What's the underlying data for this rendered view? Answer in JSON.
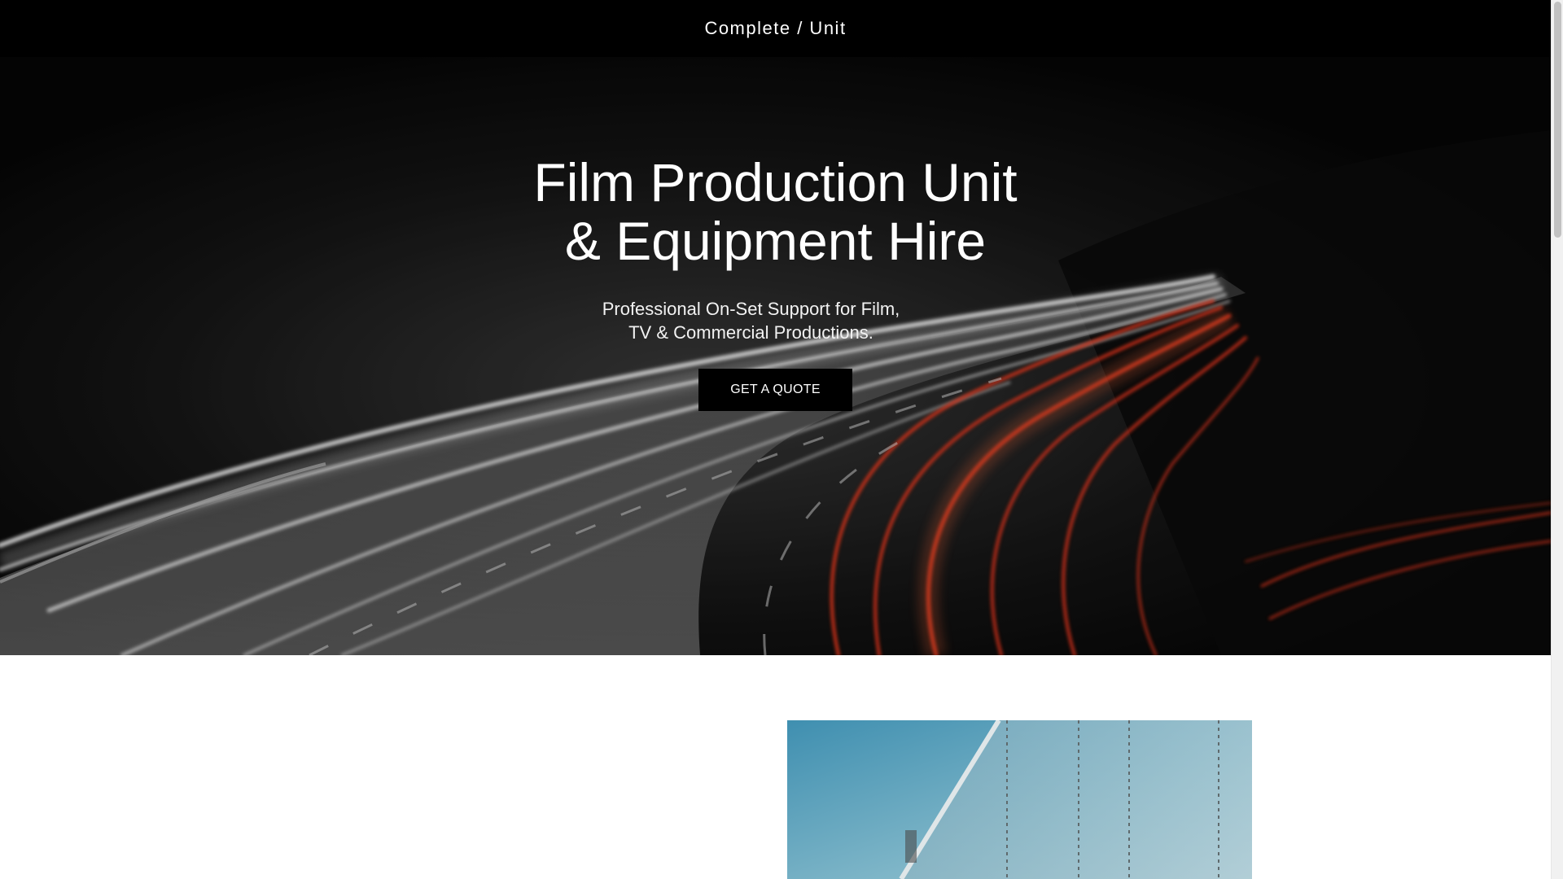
{
  "header": {
    "brand": "Complete / Unit"
  },
  "hero": {
    "title": "Film Production Unit\n& Equipment Hire",
    "subtitle": "Professional On-Set Support for Film,\nTV & Commercial Productions.",
    "cta_label": "GET A QUOTE",
    "background": "night-highway-light-trails-photo"
  },
  "section": {
    "image": "truck-trailer-sky-photo"
  },
  "colors": {
    "header_bg": "#000000",
    "button_bg": "#000000",
    "text": "#ffffff",
    "light_trail_red": "#ff3b1f",
    "light_trail_white": "#ffffff"
  }
}
